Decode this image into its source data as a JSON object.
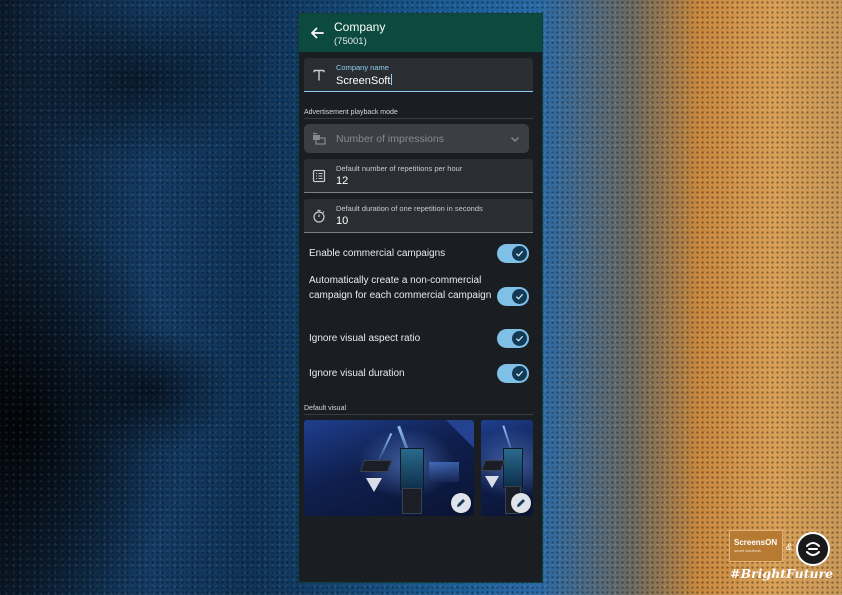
{
  "header": {
    "title": "Company",
    "subtitle": "(75001)"
  },
  "company_field": {
    "label": "Company name",
    "value": "ScreenSoft"
  },
  "playback_section": {
    "label": "Advertisement playback mode"
  },
  "playback_select": {
    "value": "Number of impressions"
  },
  "repetitions_field": {
    "label": "Default number of repetitions per hour",
    "value": "12"
  },
  "duration_field": {
    "label": "Default duration of one repetition in seconds",
    "value": "10"
  },
  "toggles": [
    {
      "label": "Enable commercial campaigns",
      "on": true
    },
    {
      "label": "Automatically create a non-commercial campaign for each commercial campaign",
      "on": true
    },
    {
      "label": "Ignore visual aspect ratio",
      "on": true
    },
    {
      "label": "Ignore visual duration",
      "on": true
    }
  ],
  "visual_section": {
    "label": "Default visual"
  },
  "brand": {
    "name": "ScreensON",
    "tagline": "smart solutions",
    "amp": "&",
    "hashtag": "#BrightFuture"
  },
  "colors": {
    "accent": "#8ecdf0",
    "header": "#0c4a40",
    "toggle": "#7ec0e6",
    "panel": "#1a1d21"
  },
  "icons": {
    "back": "arrow-left-icon",
    "text": "text-format-icon",
    "select": "playback-mode-icon",
    "list": "list-icon",
    "timer": "timer-icon",
    "chevron": "chevron-down-icon",
    "check": "check-icon",
    "edit": "pencil-icon"
  }
}
